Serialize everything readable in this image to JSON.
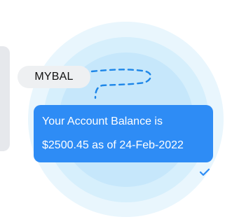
{
  "conversation": {
    "sent_message": "MYBAL",
    "reply_lines": [
      "Your Account Balance is",
      "$2500.45 as of 24-Feb-2022"
    ],
    "delivered_icon": "check-icon"
  },
  "colors": {
    "sent_bubble": "#eef0f2",
    "reply_bubble": "#2e8cf5",
    "connector": "#1d86e8",
    "halo_outer": "#e9f6fd",
    "halo_inner": "#c6e7fb"
  }
}
